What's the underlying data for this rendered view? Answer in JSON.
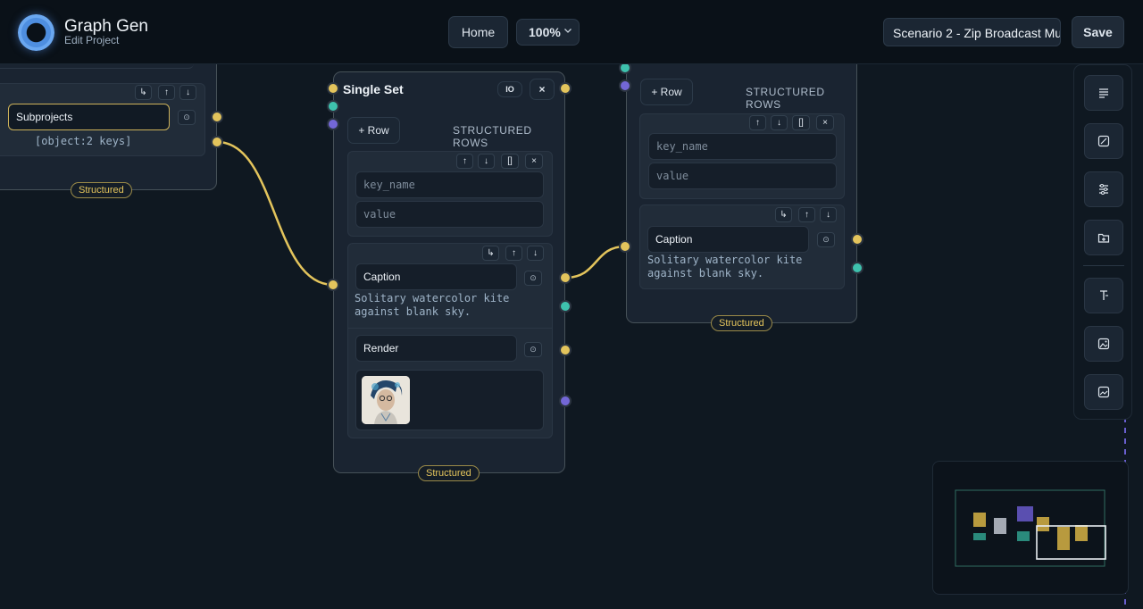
{
  "header": {
    "app_title": "Graph Gen",
    "app_subtitle": "Edit Project",
    "home_label": "Home",
    "zoom_value": "100%",
    "scenario_name": "Scenario 2 - Zip Broadcast Mu",
    "save_label": "Save"
  },
  "colors": {
    "accent_yellow": "#e3c45c",
    "accent_teal": "#3ec2ae",
    "accent_purple": "#7367d6",
    "brand_blue": "#4e8ee0"
  },
  "left_node": {
    "row_label": "Subprojects",
    "row_value": "[object:2 keys]",
    "badge": "Structured"
  },
  "center_node": {
    "title": "Single Set",
    "io_label": "IO",
    "close_label": "×",
    "add_row_label": "+ Row",
    "rows_header": "STRUCTURED ROWS",
    "key_placeholder": "key_name",
    "value_placeholder": "value",
    "caption_label": "Caption",
    "caption_text": "Solitary watercolor kite against blank sky.",
    "render_label": "Render",
    "badge": "Structured"
  },
  "right_node": {
    "add_row_label": "+ Row",
    "rows_header": "STRUCTURED ROWS",
    "key_placeholder": "key_name",
    "value_placeholder": "value",
    "caption_label": "Caption",
    "caption_text": "Solitary watercolor kite against blank sky.",
    "badge": "Structured"
  },
  "glyphs": {
    "indent": "↳",
    "up": "↑",
    "down": "↓",
    "brackets": "[]",
    "remove": "×",
    "dot": "⊙"
  },
  "toolbar": {
    "icons": [
      "text-lines-icon",
      "image-pen-icon",
      "sliders-icon",
      "folder-plus-icon",
      "text-cursor-icon",
      "image-upload-icon",
      "image-icon"
    ]
  }
}
